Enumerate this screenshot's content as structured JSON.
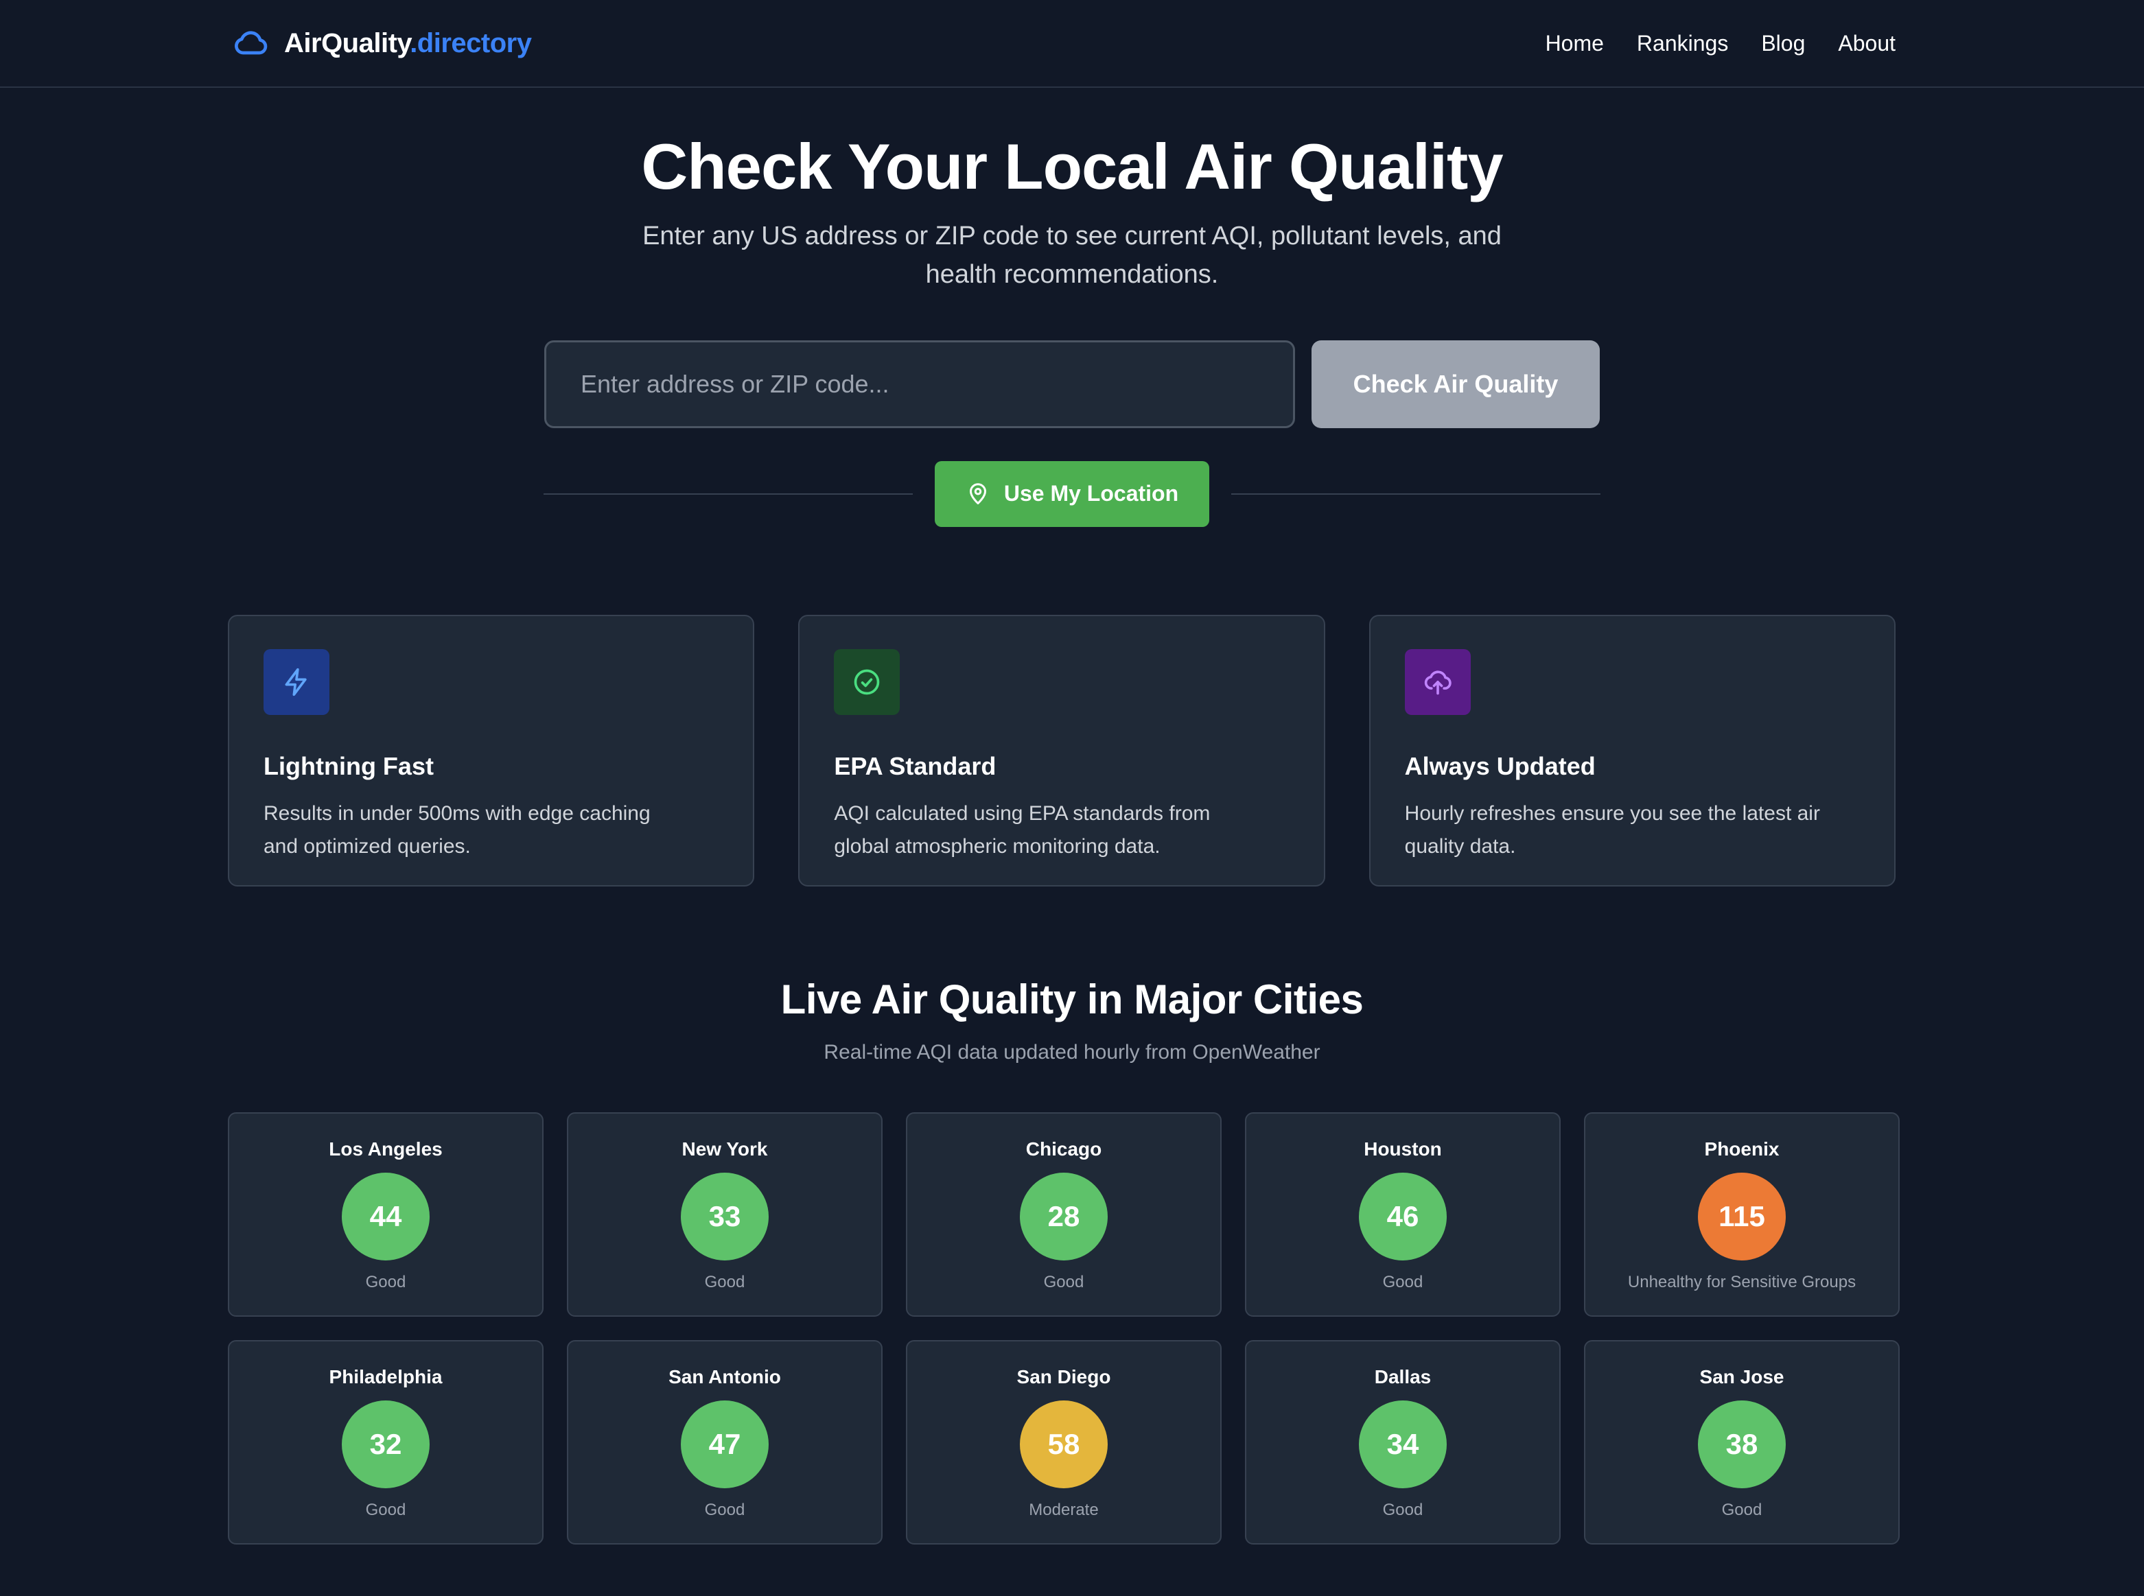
{
  "brand": {
    "name_primary": "AirQuality",
    "name_secondary": ".directory"
  },
  "nav": [
    "Home",
    "Rankings",
    "Blog",
    "About"
  ],
  "hero": {
    "title": "Check Your Local Air Quality",
    "subtitle_line1": "Enter any US address or ZIP code to see current AQI, pollutant levels, and",
    "subtitle_line2": "health recommendations."
  },
  "search": {
    "placeholder": "Enter address or ZIP code...",
    "value": "",
    "button": "Check Air Quality"
  },
  "location_button": "Use My Location",
  "features": [
    {
      "title": "Lightning Fast",
      "desc_line1": "Results in under 500ms with edge caching",
      "desc_line2": "and optimized queries.",
      "icon": "lightning-icon",
      "icon_bg": "#1e3a8a",
      "icon_color": "#60a5fa"
    },
    {
      "title": "EPA Standard",
      "desc_line1": "AQI calculated using EPA standards from",
      "desc_line2": "global atmospheric monitoring data.",
      "icon": "check-circle-icon",
      "icon_bg": "#14532d",
      "icon_color": "#4ade80"
    },
    {
      "title": "Always Updated",
      "desc_line1": "Hourly refreshes ensure you see the latest air",
      "desc_line2": "quality data.",
      "icon": "cloud-upload-icon",
      "icon_bg": "#581c87",
      "icon_color": "#c084fc"
    }
  ],
  "cities_section": {
    "title": "Live Air Quality in Major Cities",
    "subtitle": "Real-time AQI data updated hourly from OpenWeather"
  },
  "cities": [
    {
      "name": "Los Angeles",
      "aqi": "44",
      "status": "Good",
      "color": "#5ec26a"
    },
    {
      "name": "New York",
      "aqi": "33",
      "status": "Good",
      "color": "#5ec26a"
    },
    {
      "name": "Chicago",
      "aqi": "28",
      "status": "Good",
      "color": "#5ec26a"
    },
    {
      "name": "Houston",
      "aqi": "46",
      "status": "Good",
      "color": "#5ec26a"
    },
    {
      "name": "Phoenix",
      "aqi": "115",
      "status": "Unhealthy for Sensitive Groups",
      "color": "#ec7a35"
    },
    {
      "name": "Philadelphia",
      "aqi": "32",
      "status": "Good",
      "color": "#5ec26a"
    },
    {
      "name": "San Antonio",
      "aqi": "47",
      "status": "Good",
      "color": "#5ec26a"
    },
    {
      "name": "San Diego",
      "aqi": "58",
      "status": "Moderate",
      "color": "#e4b63c"
    },
    {
      "name": "Dallas",
      "aqi": "34",
      "status": "Good",
      "color": "#5ec26a"
    },
    {
      "name": "San Jose",
      "aqi": "38",
      "status": "Good",
      "color": "#5ec26a"
    }
  ],
  "colors": {
    "accent_blue": "#3b82f6",
    "background": "#111827",
    "card": "#1f2937",
    "location_green": "#4caf50"
  }
}
